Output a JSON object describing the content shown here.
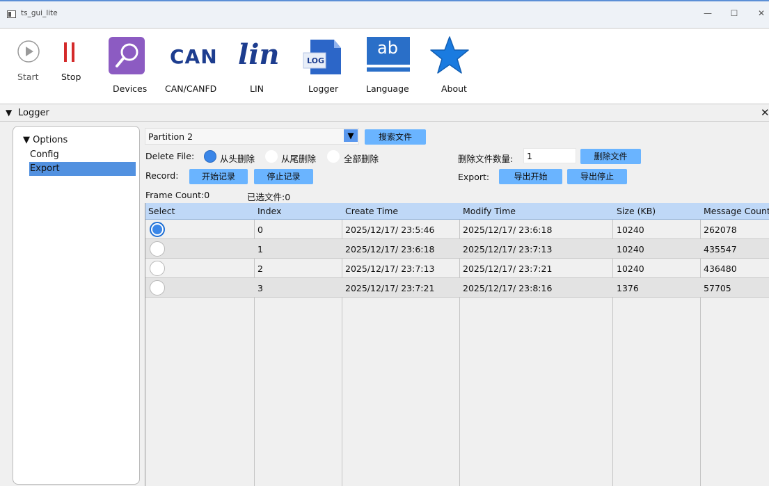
{
  "window": {
    "title": "ts_gui_lite",
    "controls": [
      "—",
      "☐",
      "✕"
    ]
  },
  "toolbar": {
    "start_label": "Start",
    "stop_label": "Stop",
    "devices_label": "Devices",
    "can_label": "CAN/CANFD",
    "can_logo": "CAN",
    "lin_label": "LIN",
    "lin_logo": "lin",
    "logger_label": "Logger",
    "logger_logo": "LOG",
    "language_label": "Language",
    "language_logo": "ab",
    "about_label": "About"
  },
  "panel": {
    "title": "Logger",
    "arrow": "▼",
    "close": "✕"
  },
  "options": {
    "root": "▼ Options",
    "items": [
      "Config",
      "Export"
    ],
    "selected": "Export"
  },
  "controls": {
    "partition": "Partition 2",
    "search_button": "搜索文件",
    "delete_file_label": "Delete File:",
    "delete_modes": [
      "从头删除",
      "从尾删除",
      "全部删除"
    ],
    "delete_selected": "从头删除",
    "delete_count_label": "删除文件数量:",
    "delete_count_value": "1",
    "delete_button": "删除文件",
    "record_label": "Record:",
    "record_start": "开始记录",
    "record_stop": "停止记录",
    "export_label": "Export:",
    "export_start": "导出开始",
    "export_stop": "导出停止",
    "frame_count": "Frame Count:0",
    "selected_files": "已选文件:0"
  },
  "table": {
    "columns": [
      "Select",
      "Index",
      "Create Time",
      "Modify Time",
      "Size (KB)",
      "Message Count"
    ],
    "rows": [
      {
        "selected": true,
        "index": "0",
        "create": "2025/12/17/ 23:5:46",
        "modify": "2025/12/17/ 23:6:18",
        "size": "10240",
        "messages": "262078"
      },
      {
        "selected": false,
        "index": "1",
        "create": "2025/12/17/ 23:6:18",
        "modify": "2025/12/17/ 23:7:13",
        "size": "10240",
        "messages": "435547"
      },
      {
        "selected": false,
        "index": "2",
        "create": "2025/12/17/ 23:7:13",
        "modify": "2025/12/17/ 23:7:21",
        "size": "10240",
        "messages": "436480"
      },
      {
        "selected": false,
        "index": "3",
        "create": "2025/12/17/ 23:7:21",
        "modify": "2025/12/17/ 23:8:16",
        "size": "1376",
        "messages": "57705"
      }
    ]
  },
  "colors": {
    "accent": "#6ab4ff",
    "header_blue": "#bfd8f7",
    "selection": "#5291e0",
    "stop_red": "#d42a2a",
    "can_navy": "#1d3d8f"
  }
}
